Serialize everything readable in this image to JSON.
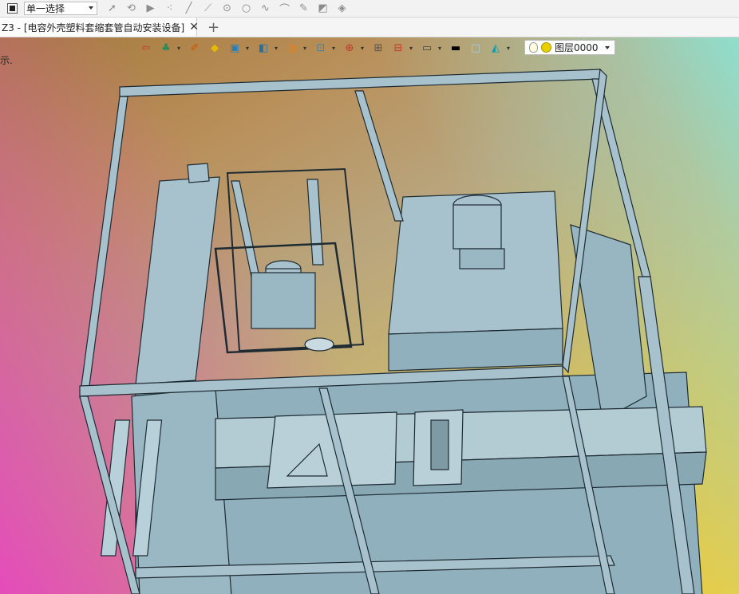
{
  "toolbar": {
    "selection_mode": "单一选择",
    "icons": [
      "cursor-icon",
      "rotate-select-icon",
      "play-icon",
      "point-cloud-icon",
      "line-icon",
      "line-segment-icon",
      "circle-center-icon",
      "circle-icon",
      "curve-icon",
      "arc-icon",
      "pen-icon",
      "fill-icon",
      "surface-icon"
    ]
  },
  "tab": {
    "title": "Z3 - [电容外壳塑料套缩套管自动安装设备]",
    "close": "✕",
    "new_tab": "+"
  },
  "viewport": {
    "hint_text": "示.",
    "view_toolbar_icons": [
      "exit-icon",
      "palette-icon",
      "pen-color-icon",
      "shade-icon",
      "box-icon",
      "box-view-icon",
      "section-icon",
      "zoom-icon",
      "target-icon",
      "frame-icon",
      "dimension-icon",
      "display-icon",
      "line-color-icon",
      "fill-color-icon",
      "layers-icon"
    ],
    "layer_label": "图层0000",
    "colors": {
      "model": "#a7c2cc",
      "model_dark": "#6f8e99",
      "line": "#1e2b33"
    }
  }
}
